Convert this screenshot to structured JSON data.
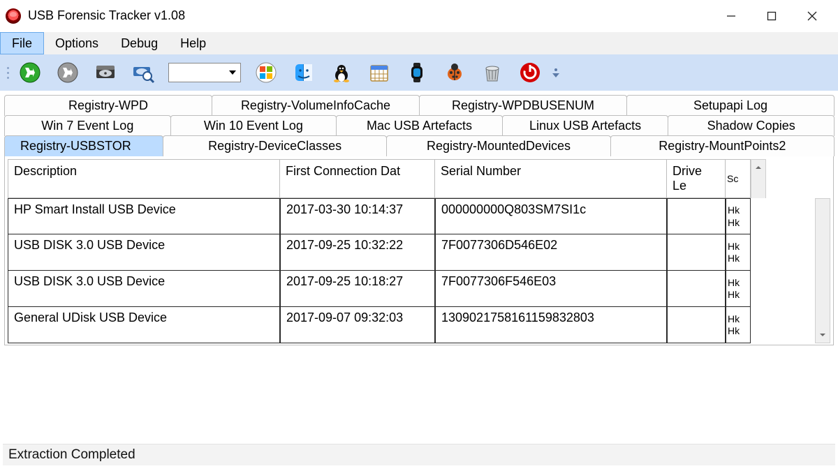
{
  "window": {
    "title": "USB Forensic Tracker v1.08"
  },
  "menubar": {
    "file": "File",
    "options": "Options",
    "debug": "Debug",
    "help": "Help"
  },
  "toolbar_icons": {
    "run_green": "run-green-icon",
    "run_grey": "run-grey-icon",
    "disk": "disk-icon",
    "disk_search": "disk-magnify-icon",
    "combo_placeholder": "",
    "windows": "windows-logo-icon",
    "mac": "mac-finder-icon",
    "linux": "linux-tux-icon",
    "calendar": "calendar-icon",
    "watch": "watch-icon",
    "bug": "bug-icon",
    "trash": "trash-icon",
    "power": "power-icon"
  },
  "tabs": {
    "row1": [
      "Registry-WPD",
      "Registry-VolumeInfoCache",
      "Registry-WPDBUSENUM",
      "Setupapi Log"
    ],
    "row2": [
      "Win 7 Event Log",
      "Win 10 Event Log",
      "Mac USB Artefacts",
      "Linux USB Artefacts",
      "Shadow Copies"
    ],
    "row3": [
      "Registry-USBSTOR",
      "Registry-DeviceClasses",
      "Registry-MountedDevices",
      "Registry-MountPoints2"
    ],
    "active": "Registry-USBSTOR"
  },
  "table": {
    "columns": {
      "description": "Description",
      "first_conn": "First Connection Dat",
      "serial": "Serial Number",
      "drive": "Drive Le",
      "source": "Sc"
    },
    "rows": [
      {
        "description": "HP Smart Install USB Device",
        "first_conn": "2017-03-30 10:14:37",
        "serial": "000000000Q803SM7SI1c",
        "drive": "",
        "sc1": "Hk",
        "sc2": "Hk"
      },
      {
        "description": "USB DISK 3.0 USB Device",
        "first_conn": "2017-09-25 10:32:22",
        "serial": "7F0077306D546E02",
        "drive": "",
        "sc1": "Hk",
        "sc2": "Hk"
      },
      {
        "description": "USB DISK 3.0 USB Device",
        "first_conn": "2017-09-25 10:18:27",
        "serial": "7F0077306F546E03",
        "drive": "",
        "sc1": "Hk",
        "sc2": "Hk"
      },
      {
        "description": "General UDisk USB Device",
        "first_conn": "2017-09-07 09:32:03",
        "serial": "1309021758161159832803",
        "drive": "",
        "sc1": "Hk",
        "sc2": "Hk"
      }
    ]
  },
  "status": "Extraction Completed"
}
